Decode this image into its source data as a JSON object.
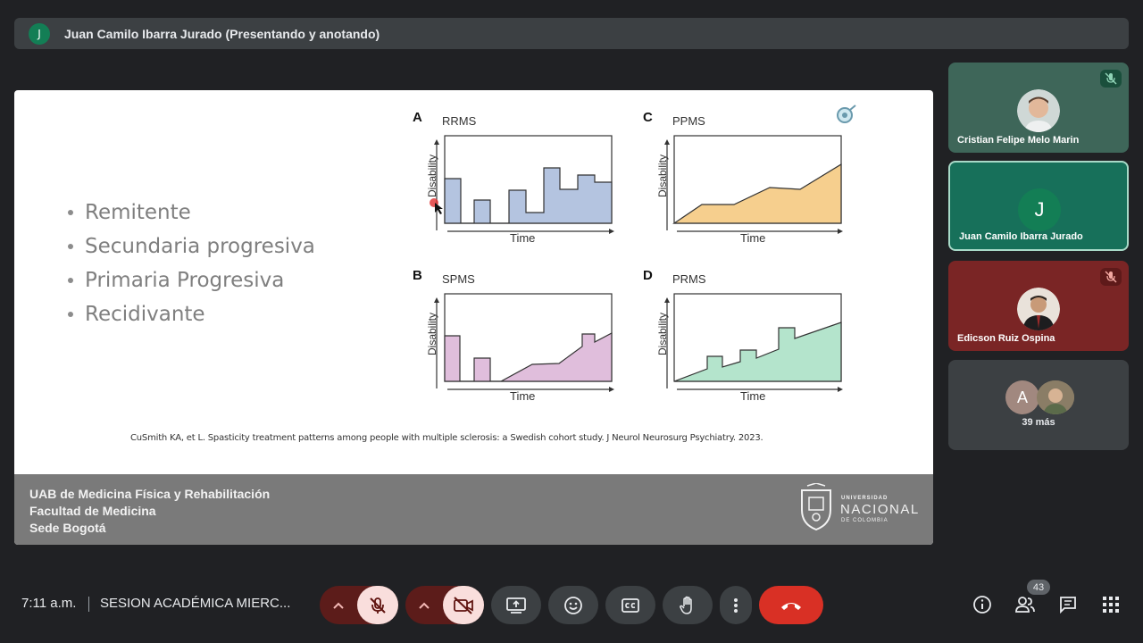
{
  "header": {
    "presenter_initial": "J",
    "presenter_label": "Juan Camilo Ibarra Jurado (Presentando y anotando)"
  },
  "slide": {
    "bullets": [
      "Remitente",
      "Secundaria progresiva",
      "Primaria Progresiva",
      "Recidivante"
    ],
    "panels": [
      {
        "letter": "A",
        "title": "RRMS",
        "ylabel": "Disability",
        "xlabel": "Time",
        "color": "#b4c4e0"
      },
      {
        "letter": "C",
        "title": "PPMS",
        "ylabel": "Disability",
        "xlabel": "Time",
        "color": "#f6cf8e"
      },
      {
        "letter": "B",
        "title": "SPMS",
        "ylabel": "Disability",
        "xlabel": "Time",
        "color": "#e0bedc"
      },
      {
        "letter": "D",
        "title": "PRMS",
        "ylabel": "Disability",
        "xlabel": "Time",
        "color": "#b4e4cc"
      }
    ],
    "citation": "CuSmith KA, et L. Spasticity treatment patterns among people with multiple sclerosis: a Swedish cohort study. J Neurol Neurosurg Psychiatry. 2023.",
    "footer": {
      "line1": "UAB de Medicina Física y Rehabilitación",
      "line2": "Facultad de Medicina",
      "line3": "Sede Bogotá",
      "logo_top": "UNIVERSIDAD",
      "logo_main": "NACIONAL",
      "logo_bottom": "DE COLOMBIA"
    }
  },
  "participants": [
    {
      "name": "Cristian Felipe Melo Marin",
      "muted": true
    },
    {
      "name": "Juan Camilo Ibarra Jurado",
      "initial": "J",
      "speaking": true
    },
    {
      "name": "Edicson Ruiz Ospina",
      "muted": true
    },
    {
      "initial": "A",
      "more_label": "39 más"
    }
  ],
  "bottom_bar": {
    "time": "7:11 a.m.",
    "meeting_name": "SESION ACADÉMICA MIERC...",
    "participant_count": "43",
    "icons": [
      "chevron-up-icon",
      "mic-off-icon",
      "chevron-up-icon",
      "camera-off-icon",
      "present-icon",
      "emoji-icon",
      "captions-icon",
      "raise-hand-icon",
      "more-options-icon",
      "hang-up-icon",
      "info-icon",
      "people-icon",
      "chat-icon",
      "activities-icon"
    ],
    "colors": {
      "hangup": "#d93025",
      "muted_bg": "#f9dedc",
      "muted_group": "#5c1c1a"
    }
  }
}
